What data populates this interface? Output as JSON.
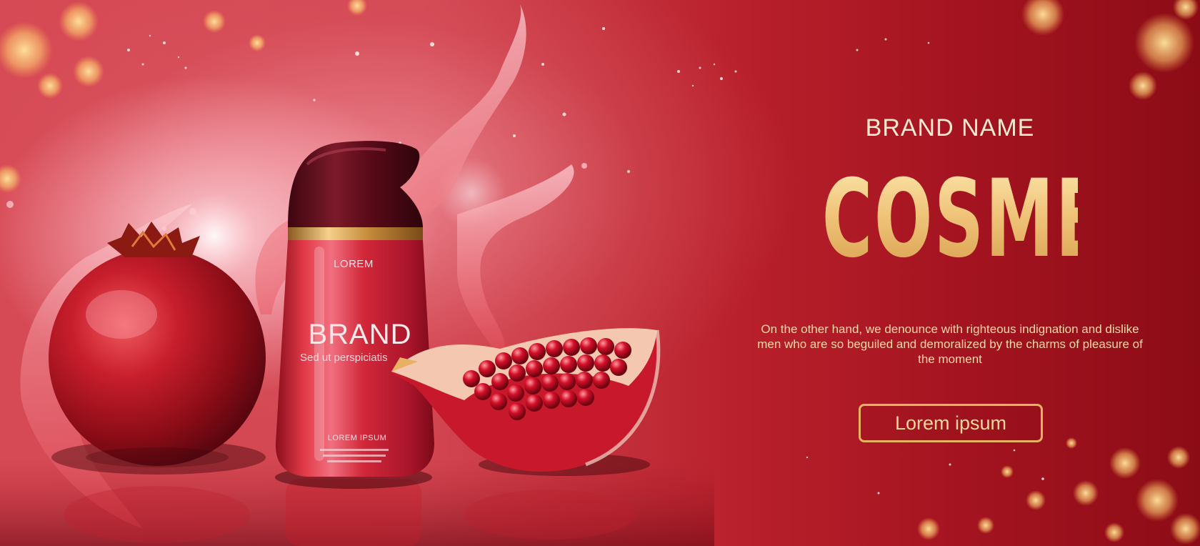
{
  "banner": {
    "brand_name": "BRAND NAME",
    "headline": "COSMETIC",
    "description": "On the other hand, we denounce with righteous indignation and dislike men who are so beguiled and demoralized by the charms of pleasure of the moment",
    "button_label": "Lorem ipsum"
  },
  "product": {
    "top_label": "LOREM",
    "brand_label": "BRAND",
    "tagline": "Sed ut perspiciatis",
    "bottom_label": "LOREM IPSUM"
  },
  "colors": {
    "background_left": "#d64a55",
    "background_right": "#8c0c16",
    "headline_gold": "#f0c47a",
    "button_border": "#e6b461",
    "bottle_red": "#c8182c",
    "cap_maroon": "#5a0a14"
  },
  "icons": [
    "pomegranate-whole",
    "pomegranate-slice",
    "cream-bottle",
    "juice-splash"
  ]
}
